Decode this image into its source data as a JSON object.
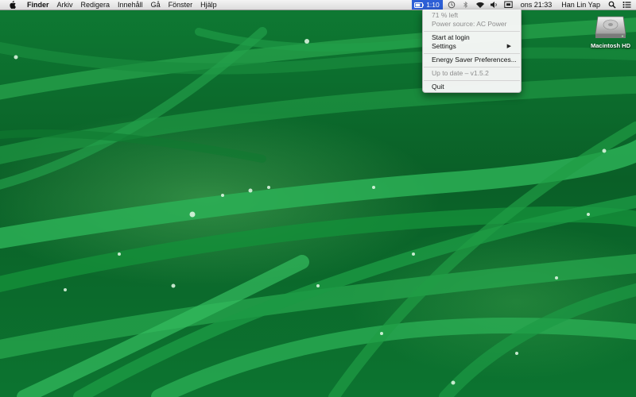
{
  "menubar": {
    "app_name": "Finder",
    "menus": [
      "Arkiv",
      "Redigera",
      "Innehåll",
      "Gå",
      "Fönster",
      "Hjälp"
    ],
    "battery_time": "1:10",
    "clock": "ons 21:33",
    "username": "Han Lin Yap",
    "status_icons": [
      "battery-icon",
      "time-machine-icon",
      "bluetooth-icon",
      "wifi-icon",
      "volume-icon",
      "display-icon",
      "search-icon",
      "notification-list-icon"
    ]
  },
  "dropdown": {
    "battery_left": "71 % left",
    "power_source": "Power source: AC Power",
    "start_at_login": "Start at login",
    "settings": "Settings",
    "energy_saver": "Energy Saver Preferences...",
    "update_status": "Up to date – v1.5.2",
    "quit": "Quit"
  },
  "desktop": {
    "hd_label": "Macintosh HD"
  },
  "colors": {
    "menubar_highlight": "#2d5fd6",
    "wallpaper_green": "#0b6a2c"
  }
}
